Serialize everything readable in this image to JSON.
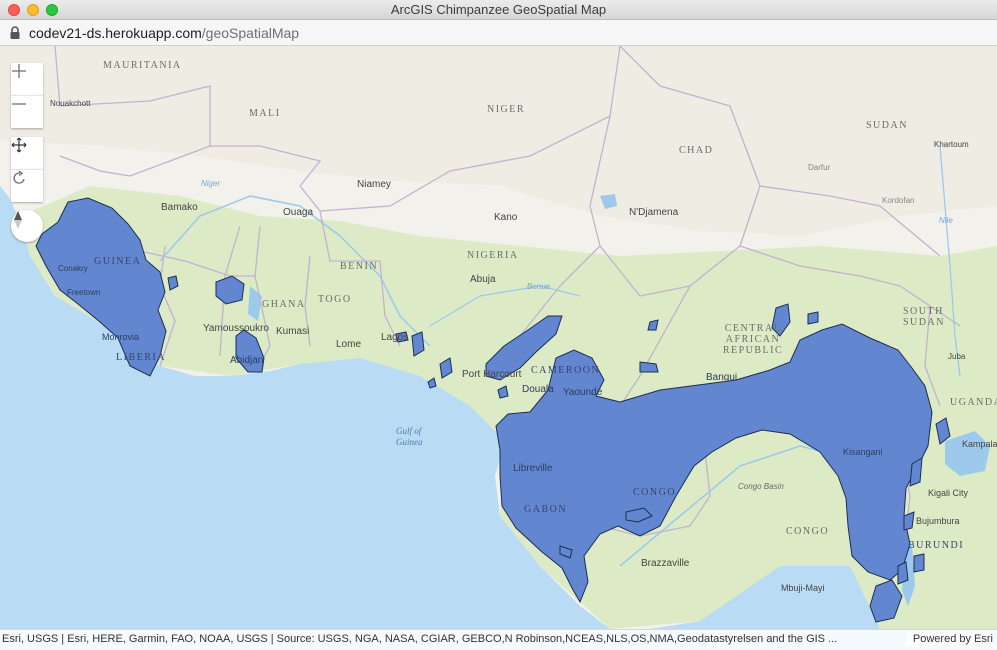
{
  "window": {
    "title": "ArcGIS Chimpanzee GeoSpatial Map"
  },
  "address_bar": {
    "host": "codev21-ds.herokuapp.com",
    "path": "/geoSpatialMap"
  },
  "map_controls": {
    "zoom_in": "zoom-in-icon",
    "zoom_out": "zoom-out-icon",
    "pan": "pan-icon",
    "rotate": "rotate-icon",
    "compass": "compass-icon"
  },
  "map": {
    "basemap": "Esri World Topographic",
    "colors": {
      "ocean": "#b9dcf4",
      "land": "#f3f1ec",
      "vegetation": "#dcebc6",
      "range_fill": "#6286cf",
      "range_stroke": "#1c2e52",
      "border": "#c3b2ce"
    },
    "country_labels": [
      "MAURITANIA",
      "MALI",
      "NIGER",
      "CHAD",
      "SUDAN",
      "NIGERIA",
      "BENIN",
      "GHANA",
      "TOGO",
      "GUINEA",
      "LIBERIA",
      "CAMEROON",
      "CENTRAL AFRICAN REPUBLIC",
      "SOUTH SUDAN",
      "GABON",
      "CONGO",
      "CONGO",
      "UGANDA",
      "BURUNDI"
    ],
    "city_labels": [
      "Nouakchott",
      "Bamako",
      "Ouaga",
      "Niamey",
      "Kano",
      "N'Djamena",
      "Khartoum",
      "Conakry",
      "Freetown",
      "Monrovia",
      "Yamoussoukro",
      "Kumasi",
      "Abidjan",
      "Lome",
      "Lagos",
      "Abuja",
      "Port Harcourt",
      "Douala",
      "Yaounde",
      "Bangui",
      "Libreville",
      "Kisangani",
      "Kampala",
      "Kigali City",
      "Bujumbura",
      "Brazzaville",
      "Mbuji-Mayi",
      "Juba"
    ],
    "water_labels": [
      "Gulf of",
      "Guinea",
      "Niger",
      "Benue",
      "Congo Basin",
      "Nile"
    ],
    "region_labels": [
      "Darfur",
      "Kordofan"
    ]
  },
  "attribution": {
    "text": "Esri, USGS | Esri, HERE, Garmin, FAO, NOAA, USGS | Source: USGS, NGA, NASA, CGIAR, GEBCO,N Robinson,NCEAS,NLS,OS,NMA,Geodatastyrelsen and the GIS ...",
    "powered_by": "Powered by Esri"
  }
}
